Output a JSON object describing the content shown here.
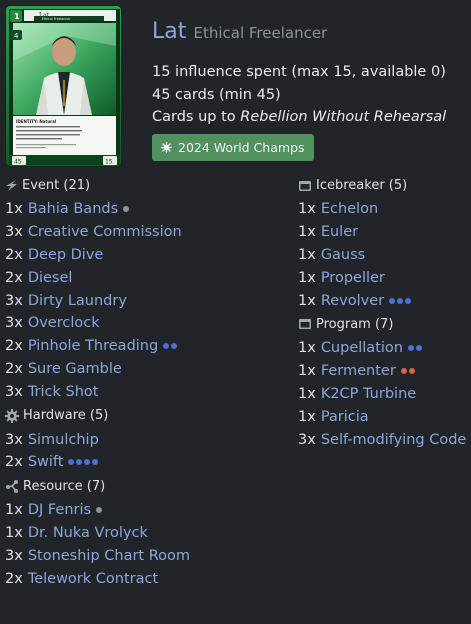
{
  "identity": {
    "name": "Lat",
    "subtitle": "Ethical Freelancer",
    "card_image": {
      "title": "Lat",
      "subtitle": "Ethical Freelancer",
      "cost": "1",
      "link": "4",
      "identity_text": "IDENTITY: Natural",
      "ability_text": "When your discard phase ends, if you have the same number of cards in your grip as the Corp has in HQ, you may draw 1 card.",
      "flavor_text": "Let's do it for fair, then back to mine for food.",
      "deck_size": "45",
      "influence": "15",
      "copyright": "© 2023 Null Signal Games. Illus. Lucinda Frost"
    }
  },
  "stats": {
    "influence": "15 influence spent (max 15, available 0)",
    "cards": "45 cards (min 45)",
    "legality_prefix": "Cards up to ",
    "legality_set": "Rebellion Without Rehearsal"
  },
  "badge": {
    "label": "2024 World Champs",
    "icon": "star-burst-icon"
  },
  "colors": {
    "link": "#8ea6d8",
    "blue_dot": "#4f6fd6",
    "orange_dot": "#d0684a",
    "grey_dot": "#8b939b",
    "badge": "#52905f"
  },
  "sections_left": [
    {
      "title": "Event (21)",
      "icon": "lightning-icon",
      "cards": [
        {
          "qty": "1x",
          "name": "Bahia Bands",
          "dots": [
            "grey"
          ]
        },
        {
          "qty": "3x",
          "name": "Creative Commission",
          "dots": []
        },
        {
          "qty": "2x",
          "name": "Deep Dive",
          "dots": []
        },
        {
          "qty": "2x",
          "name": "Diesel",
          "dots": []
        },
        {
          "qty": "3x",
          "name": "Dirty Laundry",
          "dots": []
        },
        {
          "qty": "3x",
          "name": "Overclock",
          "dots": []
        },
        {
          "qty": "2x",
          "name": "Pinhole Threading",
          "dots": [
            "blue",
            "blue"
          ]
        },
        {
          "qty": "2x",
          "name": "Sure Gamble",
          "dots": []
        },
        {
          "qty": "3x",
          "name": "Trick Shot",
          "dots": []
        }
      ]
    },
    {
      "title": "Hardware (5)",
      "icon": "gear-icon",
      "cards": [
        {
          "qty": "3x",
          "name": "Simulchip",
          "dots": []
        },
        {
          "qty": "2x",
          "name": "Swift",
          "dots": [
            "blue",
            "blue",
            "blue",
            "blue"
          ]
        }
      ]
    },
    {
      "title": "Resource (7)",
      "icon": "resource-nodes-icon",
      "cards": [
        {
          "qty": "1x",
          "name": "DJ Fenris",
          "dots": [
            "grey"
          ]
        },
        {
          "qty": "1x",
          "name": "Dr. Nuka Vrolyck",
          "dots": []
        },
        {
          "qty": "3x",
          "name": "Stoneship Chart Room",
          "dots": []
        },
        {
          "qty": "2x",
          "name": "Telework Contract",
          "dots": []
        }
      ]
    }
  ],
  "sections_right": [
    {
      "title": "Icebreaker (5)",
      "icon": "program-window-icon",
      "cards": [
        {
          "qty": "1x",
          "name": "Echelon",
          "dots": []
        },
        {
          "qty": "1x",
          "name": "Euler",
          "dots": []
        },
        {
          "qty": "1x",
          "name": "Gauss",
          "dots": []
        },
        {
          "qty": "1x",
          "name": "Propeller",
          "dots": []
        },
        {
          "qty": "1x",
          "name": "Revolver",
          "dots": [
            "blue",
            "blue",
            "blue"
          ]
        }
      ]
    },
    {
      "title": "Program (7)",
      "icon": "program-window-icon",
      "cards": [
        {
          "qty": "1x",
          "name": "Cupellation",
          "dots": [
            "blue",
            "blue"
          ]
        },
        {
          "qty": "1x",
          "name": "Fermenter",
          "dots": [
            "orange",
            "orange"
          ]
        },
        {
          "qty": "1x",
          "name": "K2CP Turbine",
          "dots": []
        },
        {
          "qty": "1x",
          "name": "Paricia",
          "dots": []
        },
        {
          "qty": "3x",
          "name": "Self-modifying Code",
          "dots": []
        }
      ]
    }
  ]
}
